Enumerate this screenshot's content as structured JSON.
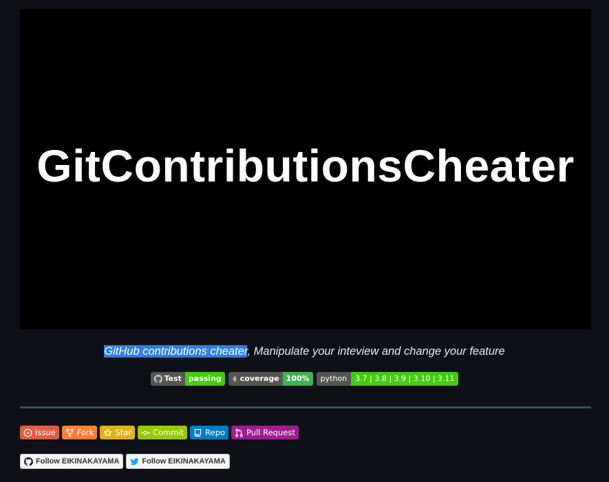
{
  "hero": {
    "title": "GitContributionsCheater"
  },
  "tagline": {
    "highlight": "GitHub contributions cheater",
    "rest": ", Manipulate your inteview and change your feature"
  },
  "status_badges": {
    "test": {
      "label": "Test",
      "value": "passing",
      "icon": "github-icon"
    },
    "coverage": {
      "label": "coverage",
      "value": "100%",
      "icon": "codeclimate-icon"
    },
    "python": {
      "label": "python",
      "value": "3.7 | 3.8 | 3.9 | 3.10 | 3.11"
    }
  },
  "link_badges": [
    {
      "label": "Issue",
      "color": "#e05d44",
      "icon": "issue-icon"
    },
    {
      "label": "Fork",
      "color": "#fe7d37",
      "icon": "fork-icon"
    },
    {
      "label": "Star",
      "color": "#dfb317",
      "icon": "star-icon"
    },
    {
      "label": "Commit",
      "color": "#97ca00",
      "icon": "commit-icon"
    },
    {
      "label": "Repo",
      "color": "#007ec6",
      "icon": "repo-icon"
    },
    {
      "label": "Pull Request",
      "color": "#9f1d8f",
      "icon": "pull-request-icon"
    }
  ],
  "follow_badges": {
    "github": {
      "label": "Follow EIKINAKAYAMA",
      "icon": "github-icon"
    },
    "twitter": {
      "label": "Follow EIKINAKAYAMA",
      "icon": "twitter-icon"
    }
  }
}
